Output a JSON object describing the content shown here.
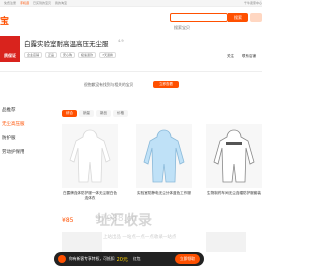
{
  "topbar": {
    "left": "免费注册",
    "mid1": "手机逛",
    "mid2": "已买到的宝贝",
    "mid3": "我的淘宝",
    "right": "千牛卖家中心"
  },
  "header": {
    "logo": "宝",
    "search_placeholder": "搜索宝贝",
    "search_button": "搜索"
  },
  "shop": {
    "logo_label": "质保证",
    "title": "白露实验室耐高温高压无尘服",
    "rating": "4.9",
    "tags": [
      "企业店铺",
      "正品",
      "安心购",
      "极速退款",
      "7天退换"
    ],
    "links": [
      "关注",
      "联系店铺"
    ]
  },
  "notice": {
    "text": "很抱歉没有找到与相关的宝贝",
    "button": "立即查看"
  },
  "sidebar": {
    "items": [
      "品推荐",
      "无尘高压服",
      "防护服",
      "劳动护保用"
    ]
  },
  "filters": [
    "综合",
    "销量",
    "新品",
    "价格"
  ],
  "products": [
    {
      "title": "白露牌连体防护服一体无尘服白色连体衣",
      "price": "¥85"
    },
    {
      "title": "实验室防静电无尘分体蓝色工作服",
      "price": ""
    },
    {
      "title": "生物制药车间无尘连帽防护服套装",
      "price": ""
    }
  ],
  "promo": {
    "text": "你有新客专享特权，可抵扣",
    "amount": "20元",
    "suffix": "红包",
    "button": "立即领取"
  },
  "watermark": {
    "main": "址汇收录",
    "num": "97988.cn",
    "small": "上站出品 一站点一点一点收录一站点"
  },
  "colors": {
    "accent": "#ff5000",
    "logo": "#d9231d"
  }
}
